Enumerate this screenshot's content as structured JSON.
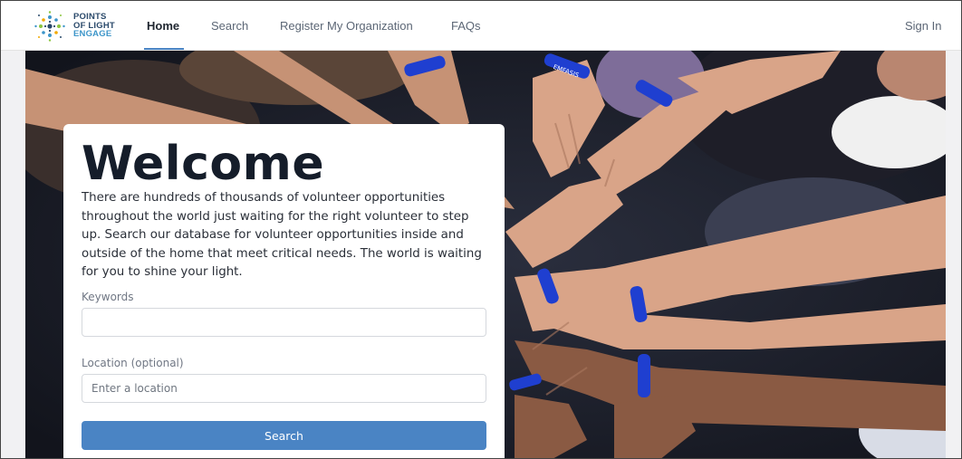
{
  "logo": {
    "line1": "POINTS",
    "line2": "OF LIGHT",
    "line3": "ENGAGE"
  },
  "nav": {
    "items": [
      {
        "label": "Home",
        "active": true
      },
      {
        "label": "Search",
        "active": false
      },
      {
        "label": "Register My Organization",
        "active": false
      },
      {
        "label": "FAQs",
        "active": false
      }
    ],
    "sign_in": "Sign In"
  },
  "hero": {
    "bracelet_text": "EMFASIS"
  },
  "card": {
    "title": "Welcome",
    "intro": "There are hundreds of thousands of volunteer opportunities throughout the world just waiting for the right volunteer to step up. Search our database for volunteer opportunities inside and outside of the home that meet critical needs. The world is waiting for you to shine your light.",
    "keywords_label": "Keywords",
    "keywords_value": "",
    "location_label": "Location (optional)",
    "location_placeholder": "Enter a location",
    "search_button": "Search"
  },
  "colors": {
    "accent": "#4a84c4",
    "logo_navy": "#2b4a6b",
    "logo_blue": "#3c95c9",
    "bracelet_blue": "#1f3fd0"
  }
}
